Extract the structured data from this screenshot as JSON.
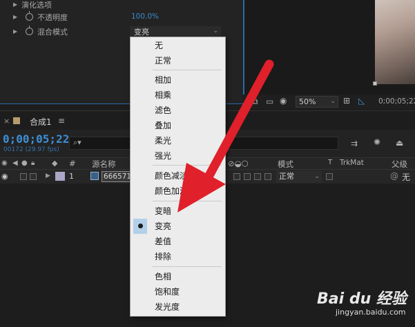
{
  "effect_panel": {
    "row0_label": "演化选项",
    "row1_label": "不透明度",
    "row1_value": "100.0%",
    "row2_label": "混合模式",
    "row2_value": "变亮"
  },
  "viewer": {
    "zoom": "50%",
    "timecode": "0;00;05;22"
  },
  "timeline": {
    "tab_close": "×",
    "comp_name": "合成1",
    "menu_glyph": "≡",
    "timecode": "0;00;05;22",
    "frame_info": "00172 (29.97 fps)",
    "columns": {
      "hash": "#",
      "source_name": "源名称",
      "mode": "模式",
      "t": "T",
      "trkmat": "TrkMat",
      "parent": "父级和"
    },
    "layer": {
      "index": "1",
      "name": "666571",
      "mode": "正常",
      "parent": "无"
    }
  },
  "blend_menu": {
    "groups": [
      [
        "无",
        "正常"
      ],
      [
        "相加",
        "相乘",
        "滤色",
        "叠加",
        "柔光",
        "强光"
      ],
      [
        "颜色减淡",
        "颜色加深"
      ],
      [
        "变暗",
        "变亮",
        "差值",
        "排除"
      ],
      [
        "色相",
        "饱和度",
        "发光度"
      ]
    ],
    "selected": "变亮"
  },
  "watermark": {
    "logo": "Bai du 经验",
    "url": "jingyan.baidu.com"
  },
  "colors": {
    "accent": "#3d8fd6",
    "arrow": "#e0202a",
    "menu_bg": "#ececec",
    "selected_highlight": "#b3d0ea"
  }
}
